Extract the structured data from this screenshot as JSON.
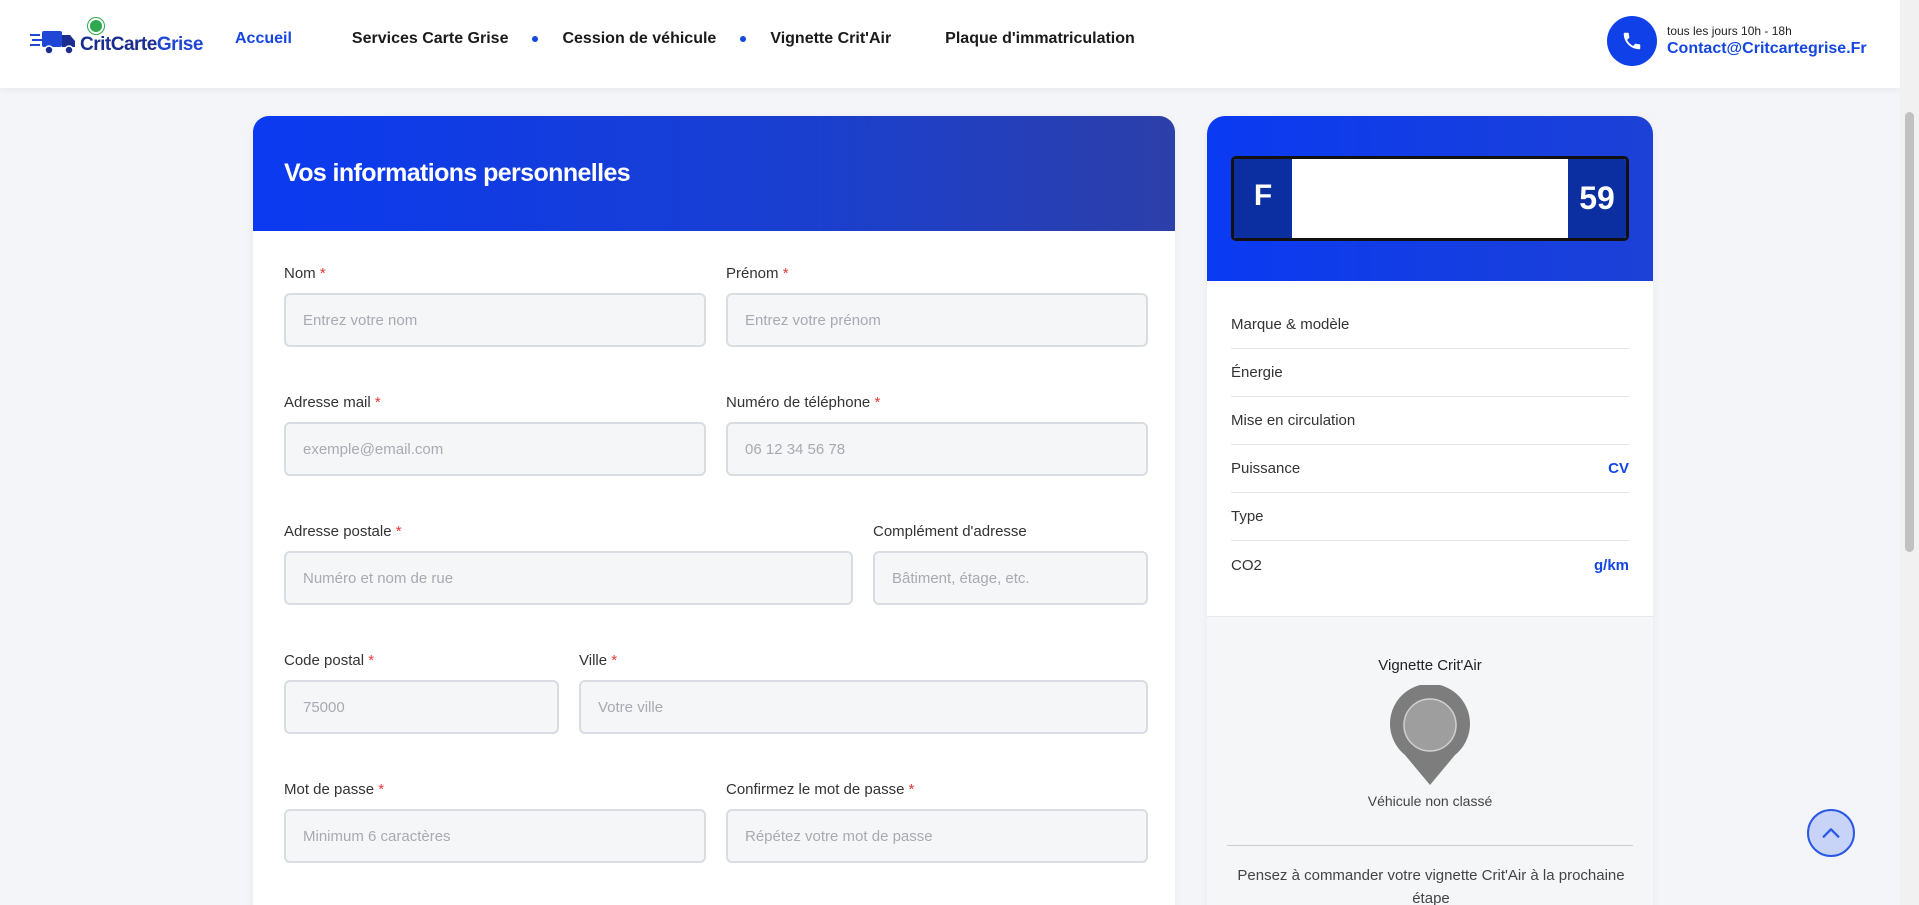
{
  "header": {
    "logo": {
      "text_a": "Crit",
      "text_b": "Carte",
      "text_c": "Grise"
    },
    "nav": [
      {
        "label": "Accueil",
        "active": true
      },
      {
        "label": "Services Carte Grise",
        "active": false
      },
      {
        "label": "Cession de véhicule",
        "active": false
      },
      {
        "label": "Vignette Crit'Air",
        "active": false
      },
      {
        "label": "Plaque d'immatriculation",
        "active": false
      }
    ],
    "contact": {
      "hours": "tous les jours 10h - 18h",
      "email": "Contact@Critcartegrise.Fr",
      "icon": "phone-icon"
    }
  },
  "form": {
    "title": "Vos informations personnelles",
    "required_mark": "*",
    "fields": {
      "nom": {
        "label": "Nom",
        "placeholder": "Entrez votre nom",
        "value": ""
      },
      "prenom": {
        "label": "Prénom",
        "placeholder": "Entrez votre prénom",
        "value": ""
      },
      "email": {
        "label": "Adresse mail",
        "placeholder": "exemple@email.com",
        "value": ""
      },
      "telephone": {
        "label": "Numéro de téléphone",
        "placeholder": "06 12 34 56 78",
        "value": ""
      },
      "adresse": {
        "label": "Adresse postale",
        "placeholder": "Numéro et nom de rue",
        "value": ""
      },
      "complement": {
        "label": "Complément d'adresse",
        "placeholder": "Bâtiment, étage, etc.",
        "value": ""
      },
      "code_postal": {
        "label": "Code postal",
        "placeholder": "75000",
        "value": ""
      },
      "ville": {
        "label": "Ville",
        "placeholder": "Votre ville",
        "value": ""
      },
      "mot_de_passe": {
        "label": "Mot de passe",
        "placeholder": "Minimum 6 caractères",
        "value": ""
      },
      "confirmation": {
        "label": "Confirmez le mot de passe",
        "placeholder": "Répétez votre mot de passe",
        "value": ""
      }
    }
  },
  "vehicle": {
    "plate": {
      "country": "F",
      "number": "",
      "department": "59"
    },
    "specs": [
      {
        "label": "Marque & modèle",
        "value": ""
      },
      {
        "label": "Énergie",
        "value": ""
      },
      {
        "label": "Mise en circulation",
        "value": ""
      },
      {
        "label": "Puissance",
        "value": "CV"
      },
      {
        "label": "Type",
        "value": ""
      },
      {
        "label": "CO2",
        "value": "g/km"
      }
    ],
    "critair": {
      "title": "Vignette Crit'Air",
      "status": "Véhicule non classé",
      "note": "Pensez à commander votre vignette Crit'Air à la prochaine étape",
      "icon": "map-pin-icon"
    }
  },
  "colors": {
    "primary": "#1446e0",
    "header_gradient_start": "#0b3af0",
    "required": "#e53935",
    "plate_blue": "#0b2fa0"
  },
  "back_to_top": {
    "icon": "chevron-up-icon"
  }
}
